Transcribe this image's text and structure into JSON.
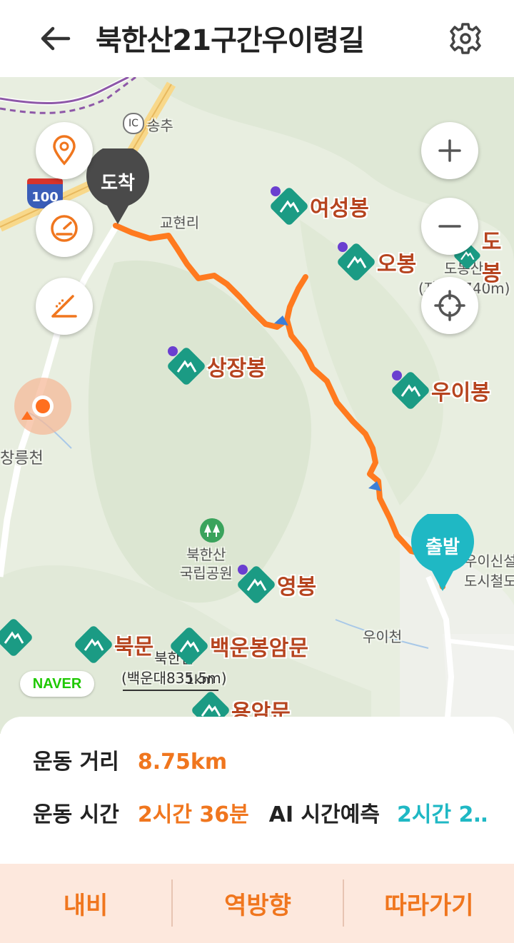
{
  "header": {
    "title": "북한산21구간우이령길",
    "back_icon": "arrow-left-icon",
    "settings_icon": "gear-icon"
  },
  "map": {
    "controls": {
      "location_icon": "location-pin-icon",
      "speed_icon": "speedometer-icon",
      "slope_icon": "slope-icon",
      "zoom_in_icon": "plus-icon",
      "zoom_out_icon": "minus-icon",
      "locate_icon": "crosshair-icon"
    },
    "pins": {
      "arrival": "도착",
      "start": "출발"
    },
    "peaks": [
      {
        "name": "여성봉"
      },
      {
        "name": "오봉"
      },
      {
        "name": "상장봉"
      },
      {
        "name": "우이봉"
      },
      {
        "name": "영봉"
      },
      {
        "name": "북문"
      },
      {
        "name": "백운봉암문"
      },
      {
        "name": "용암문"
      }
    ],
    "places": {
      "ic": "IC",
      "songchu": "송추",
      "highway": "100",
      "gyohyeonri": "교현리",
      "changneungcheon": "창릉천",
      "bukhansan_park": "북한산\n국립공원",
      "uicheon": "우이천",
      "dobongsan": "도봉산",
      "dobongsan_alt": "(자운봉740m)",
      "dobong": "도봉",
      "baekundae": "북한산\n(백운대835.5m)",
      "sinseol": "우이신설\n도시철도",
      "naver": "NAVER",
      "scale": "1km"
    }
  },
  "stats": {
    "distance_label": "운동 거리",
    "distance_value": "8.75km",
    "time_label": "운동 시간",
    "time_value": "2시간 36분",
    "ai_label": "AI 시간예측",
    "ai_value": "2시간 2‥"
  },
  "actions": {
    "navi": "내비",
    "reverse": "역방향",
    "follow": "따라가기"
  },
  "colors": {
    "accent": "#f0761e",
    "route": "#ff7a1f",
    "start_pin": "#1fb8c4",
    "peak_icon": "#1b9b84",
    "label": "#b6441f"
  }
}
